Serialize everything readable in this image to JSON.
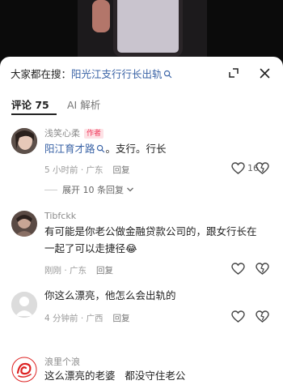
{
  "search": {
    "prefix": "大家都在搜：",
    "query": "阳光江支行行长出轨"
  },
  "tabs": [
    {
      "label": "评论 75"
    },
    {
      "label": "AI 解析"
    }
  ],
  "comments": [
    {
      "username": "浅笑心柔",
      "badge": "作者",
      "mention": "阳江育才路",
      "text": "。支行。行长",
      "time": "5 小时前 · 广东",
      "reply": "回复",
      "likes": "16",
      "expand": "展开 10 条回复"
    },
    {
      "username": "Tibfckk",
      "line1": "有可能是你老公做金融贷款公司的，跟女行长在",
      "line2": "一起了可以走捷径",
      "emoji": "😂",
      "time": "刚刚 · 广东",
      "reply": "回复"
    },
    {
      "username": "",
      "text": "你这么漂亮，他怎么会出轨的",
      "time": "4 分钟前 · 广西",
      "reply": "回复"
    },
    {
      "username": "浪里个浪",
      "text": "这么漂亮的老婆   都没守住老公"
    }
  ],
  "colors": {
    "link": "#3a63a6",
    "badge_bg": "#fde1e5",
    "badge_text": "#f0375a"
  }
}
